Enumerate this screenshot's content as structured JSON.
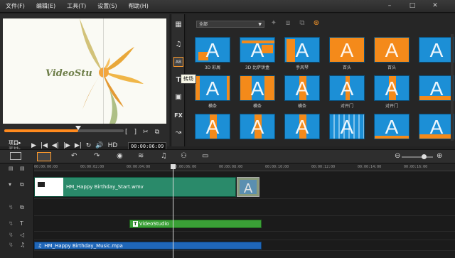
{
  "menu": [
    "文件(F)",
    "编辑(E)",
    "工具(T)",
    "设置(S)",
    "帮助(H)"
  ],
  "window_controls": [
    "–",
    "□",
    "✕"
  ],
  "preview": {
    "logo_text": "VideoStu"
  },
  "player": {
    "scrub_progress": 0.62,
    "mode_project": "项目▸",
    "mode_clip": "素材▸",
    "timecode": "00:00:06:09",
    "hd_label": "HD",
    "controls": [
      "▶",
      "|◀",
      "◀|",
      "|▶",
      "▶|",
      "↻",
      "🔊"
    ],
    "marks": [
      "[",
      "]",
      "✂",
      "⧉"
    ]
  },
  "categories": [
    {
      "icon": "▦",
      "name": "media"
    },
    {
      "icon": "♫",
      "name": "instant-project"
    },
    {
      "icon": "AB",
      "name": "transition"
    },
    {
      "icon": "T",
      "name": "title"
    },
    {
      "icon": "▣",
      "name": "graphic"
    },
    {
      "icon": "FX",
      "name": "filter"
    },
    {
      "icon": "↝",
      "name": "path"
    }
  ],
  "tooltip": "转场",
  "library": {
    "filter_value": "全部",
    "icons": [
      "✦",
      "⧈",
      "⧉",
      "⊛"
    ]
  },
  "tiles": [
    {
      "label": "3D 彩屑"
    },
    {
      "label": "3D 比萨饼盒"
    },
    {
      "label": "手风琴"
    },
    {
      "label": "百头"
    },
    {
      "label": "百头"
    },
    {
      "label": ""
    },
    {
      "label": "横条"
    },
    {
      "label": "横条"
    },
    {
      "label": "横条"
    },
    {
      "label": "对开门"
    },
    {
      "label": "对开门"
    },
    {
      "label": ""
    },
    {
      "label": ""
    },
    {
      "label": ""
    },
    {
      "label": ""
    },
    {
      "label": ""
    },
    {
      "label": ""
    },
    {
      "label": ""
    }
  ],
  "ruler_ticks": [
    "00:00:00:00",
    "00:00:02:00",
    "00:00:04:00",
    "00:00:06:00",
    "00:00:08:00",
    "00:00:10:00",
    "00:00:12:00",
    "00:00:14:00",
    "00:00:16:00"
  ],
  "clips": {
    "video": "HM_Happy Birthday_Start.wmv",
    "transition_letter": "A",
    "title_badge": "T",
    "title": "VideoStudio",
    "music_badge": "♫",
    "music": "HM_Happy Birthday_Music.mpa"
  },
  "colors": {
    "accent": "#ff9a2a",
    "tile_blue": "#1c8fd6",
    "tile_orange": "#f48a1a",
    "video_clip": "#2a8a6a",
    "title_clip": "#3aa036",
    "music_clip": "#1f66b8"
  }
}
